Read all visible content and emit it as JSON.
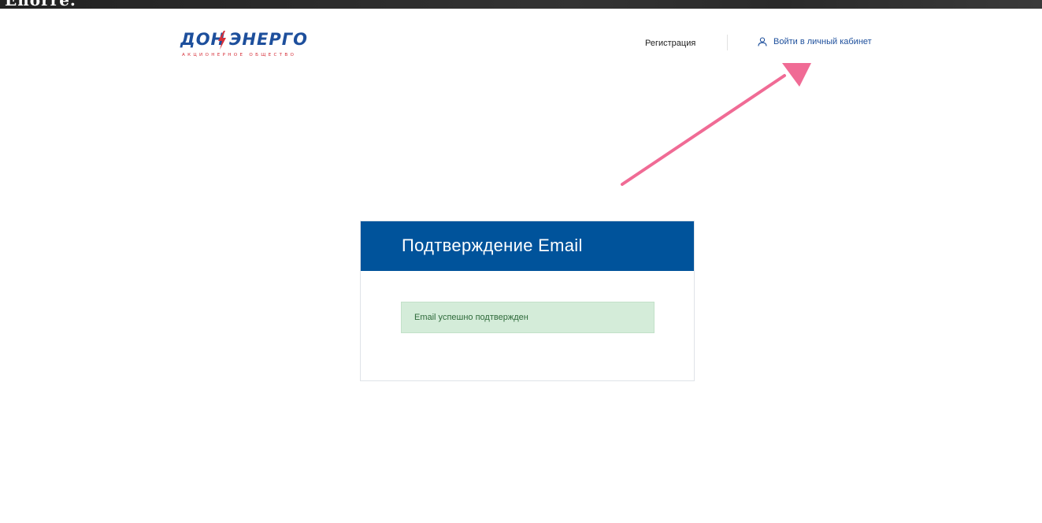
{
  "header": {
    "top_strip_text": "Enorre.",
    "logo": {
      "word_left": "ДОН",
      "word_right": "ЭНЕРГО",
      "subtitle": "АКЦИОНЕРНОЕ ОБЩЕСТВО"
    },
    "nav": {
      "register_label": "Регистрация",
      "login_label": "Войти в личный кабинет",
      "login_icon": "user-icon"
    }
  },
  "card": {
    "title": "Подтверждение Email",
    "alert_text": "Email успешно подтвержден"
  },
  "colors": {
    "brand_blue": "#00539b",
    "logo_blue": "#1d4f9c",
    "logo_red": "#d6303a",
    "alert_bg": "#d4ecd9",
    "alert_text": "#2e6a3a",
    "annotation_arrow": "#f06b95"
  }
}
